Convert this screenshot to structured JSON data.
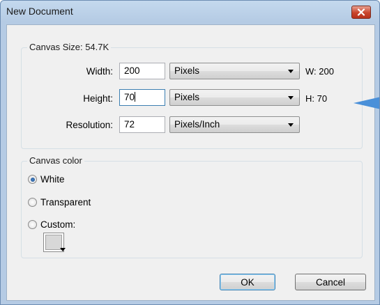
{
  "dialog": {
    "title": "New Document",
    "close_icon": "close-icon"
  },
  "canvas_size": {
    "legend": "Canvas Size: 54.7K",
    "width_label": "Width:",
    "width_value": "200",
    "width_unit": "Pixels",
    "width_readout": "W: 200",
    "height_label": "Height:",
    "height_value": "70",
    "height_unit": "Pixels",
    "height_readout": "H: 70",
    "resolution_label": "Resolution:",
    "resolution_value": "72",
    "resolution_unit": "Pixels/Inch"
  },
  "canvas_color": {
    "legend": "Canvas color",
    "options": [
      {
        "label": "White",
        "checked": true
      },
      {
        "label": "Transparent",
        "checked": false
      },
      {
        "label": "Custom:",
        "checked": false
      }
    ],
    "custom_swatch_color": "#d8d8d8"
  },
  "buttons": {
    "ok": "OK",
    "cancel": "Cancel"
  },
  "colors": {
    "focus_border": "#3c7fb1",
    "pointer": "#4a90d9"
  }
}
